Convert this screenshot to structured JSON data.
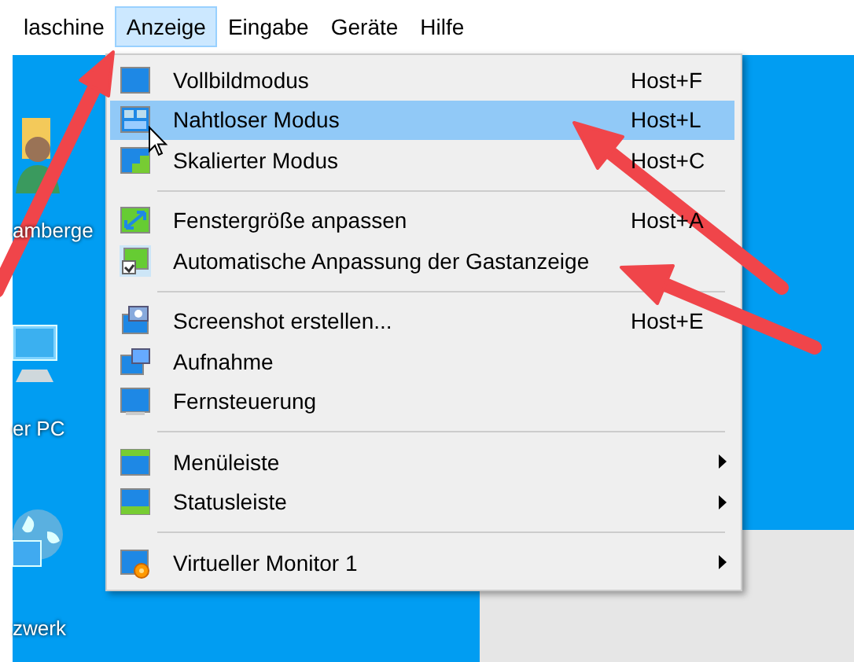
{
  "menu_bar": [
    {
      "label": "laschine",
      "selected": false
    },
    {
      "label": "Anzeige",
      "selected": true
    },
    {
      "label": "Eingabe",
      "selected": false
    },
    {
      "label": "Geräte",
      "selected": false
    },
    {
      "label": "Hilfe",
      "selected": false
    }
  ],
  "desktop_icons": [
    {
      "label": "amberge"
    },
    {
      "label": "er PC"
    },
    {
      "label": "zwerk"
    }
  ],
  "menu": [
    {
      "kind": "item",
      "label": "Vollbildmodus",
      "shortcut": "Host+F",
      "selected": false
    },
    {
      "kind": "item",
      "label": "Nahtloser Modus",
      "shortcut": "Host+L",
      "selected": true
    },
    {
      "kind": "item",
      "label": "Skalierter Modus",
      "shortcut": "Host+C",
      "selected": false
    },
    {
      "kind": "separator"
    },
    {
      "kind": "item",
      "label": "Fenstergröße anpassen",
      "shortcut": "Host+A",
      "selected": false
    },
    {
      "kind": "item",
      "label": "Automatische Anpassung der Gastanzeige",
      "checked": true,
      "selected": false
    },
    {
      "kind": "separator"
    },
    {
      "kind": "item",
      "label": "Screenshot erstellen...",
      "shortcut": "Host+E",
      "selected": false
    },
    {
      "kind": "item",
      "label": "Aufnahme",
      "selected": false
    },
    {
      "kind": "item",
      "label": "Fernsteuerung",
      "selected": false
    },
    {
      "kind": "separator"
    },
    {
      "kind": "item",
      "label": "Menüleiste",
      "submenu": true,
      "selected": false
    },
    {
      "kind": "item",
      "label": "Statusleiste",
      "submenu": true,
      "selected": false
    },
    {
      "kind": "separator"
    },
    {
      "kind": "item",
      "label": "Virtueller Monitor 1",
      "submenu": true,
      "selected": false
    }
  ]
}
